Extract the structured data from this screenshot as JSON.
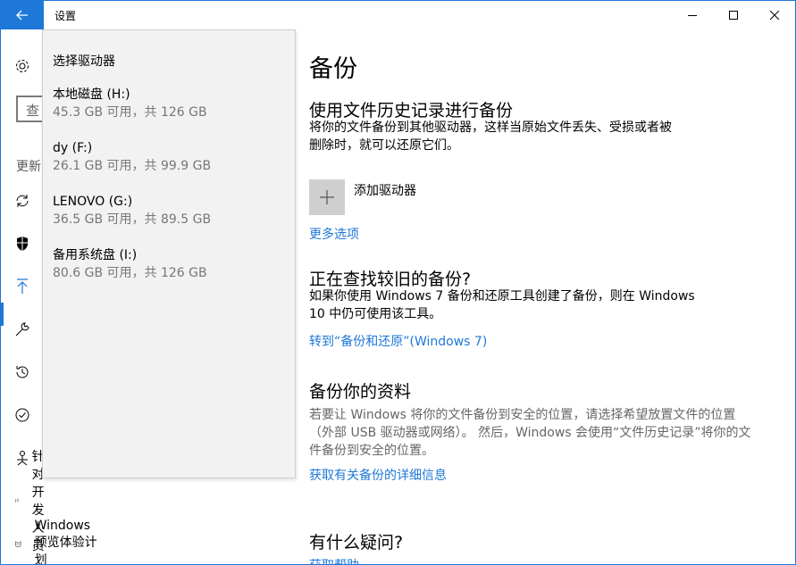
{
  "window": {
    "title": "设置"
  },
  "sidebar": {
    "search_peek": "查",
    "section_peek": "更新",
    "bottom_items": [
      {
        "label": "针对开发人员",
        "icon": "developer-tools-icon"
      },
      {
        "label": "Windows 预览体验计划",
        "icon": "insider-program-icon"
      }
    ]
  },
  "flyout": {
    "header": "选择驱动器",
    "drives": [
      {
        "name": "本地磁盘 (H:)",
        "detail": "45.3 GB 可用，共 126 GB"
      },
      {
        "name": "dy (F:)",
        "detail": "26.1 GB 可用，共 99.9 GB"
      },
      {
        "name": "LENOVO (G:)",
        "detail": "36.5 GB 可用，共 89.5 GB"
      },
      {
        "name": "备用系统盘 (I:)",
        "detail": "80.6 GB 可用，共 126 GB"
      }
    ]
  },
  "main": {
    "title": "备份",
    "file_history": {
      "heading": "使用文件历史记录进行备份",
      "desc_line1": "将你的文件备份到其他驱动器，这样当原始文件丢失、受损或者被",
      "desc_line2": "删除时，就可以还原它们。",
      "add_drive_label": "添加驱动器",
      "more_options": "更多选项"
    },
    "older_backup": {
      "heading": "正在查找较旧的备份?",
      "desc_line1": "如果你使用 Windows 7 备份和还原工具创建了备份，则在 Windows",
      "desc_line2": "10 中仍可使用该工具。",
      "link": "转到“备份和还原”(Windows 7)"
    },
    "backup_data": {
      "heading": "备份你的资料",
      "desc_line1": "若要让 Windows 将你的文件备份到安全的位置，请选择希望放置文件的位置",
      "desc_line2": "（外部 USB 驱动器或网络）。 然后，Windows 会使用“文件历史记录”将你的文",
      "desc_line3": "件备份到安全的位置。",
      "link": "获取有关备份的详细信息"
    },
    "questions": {
      "heading": "有什么疑问?",
      "link": "获取帮助"
    }
  }
}
